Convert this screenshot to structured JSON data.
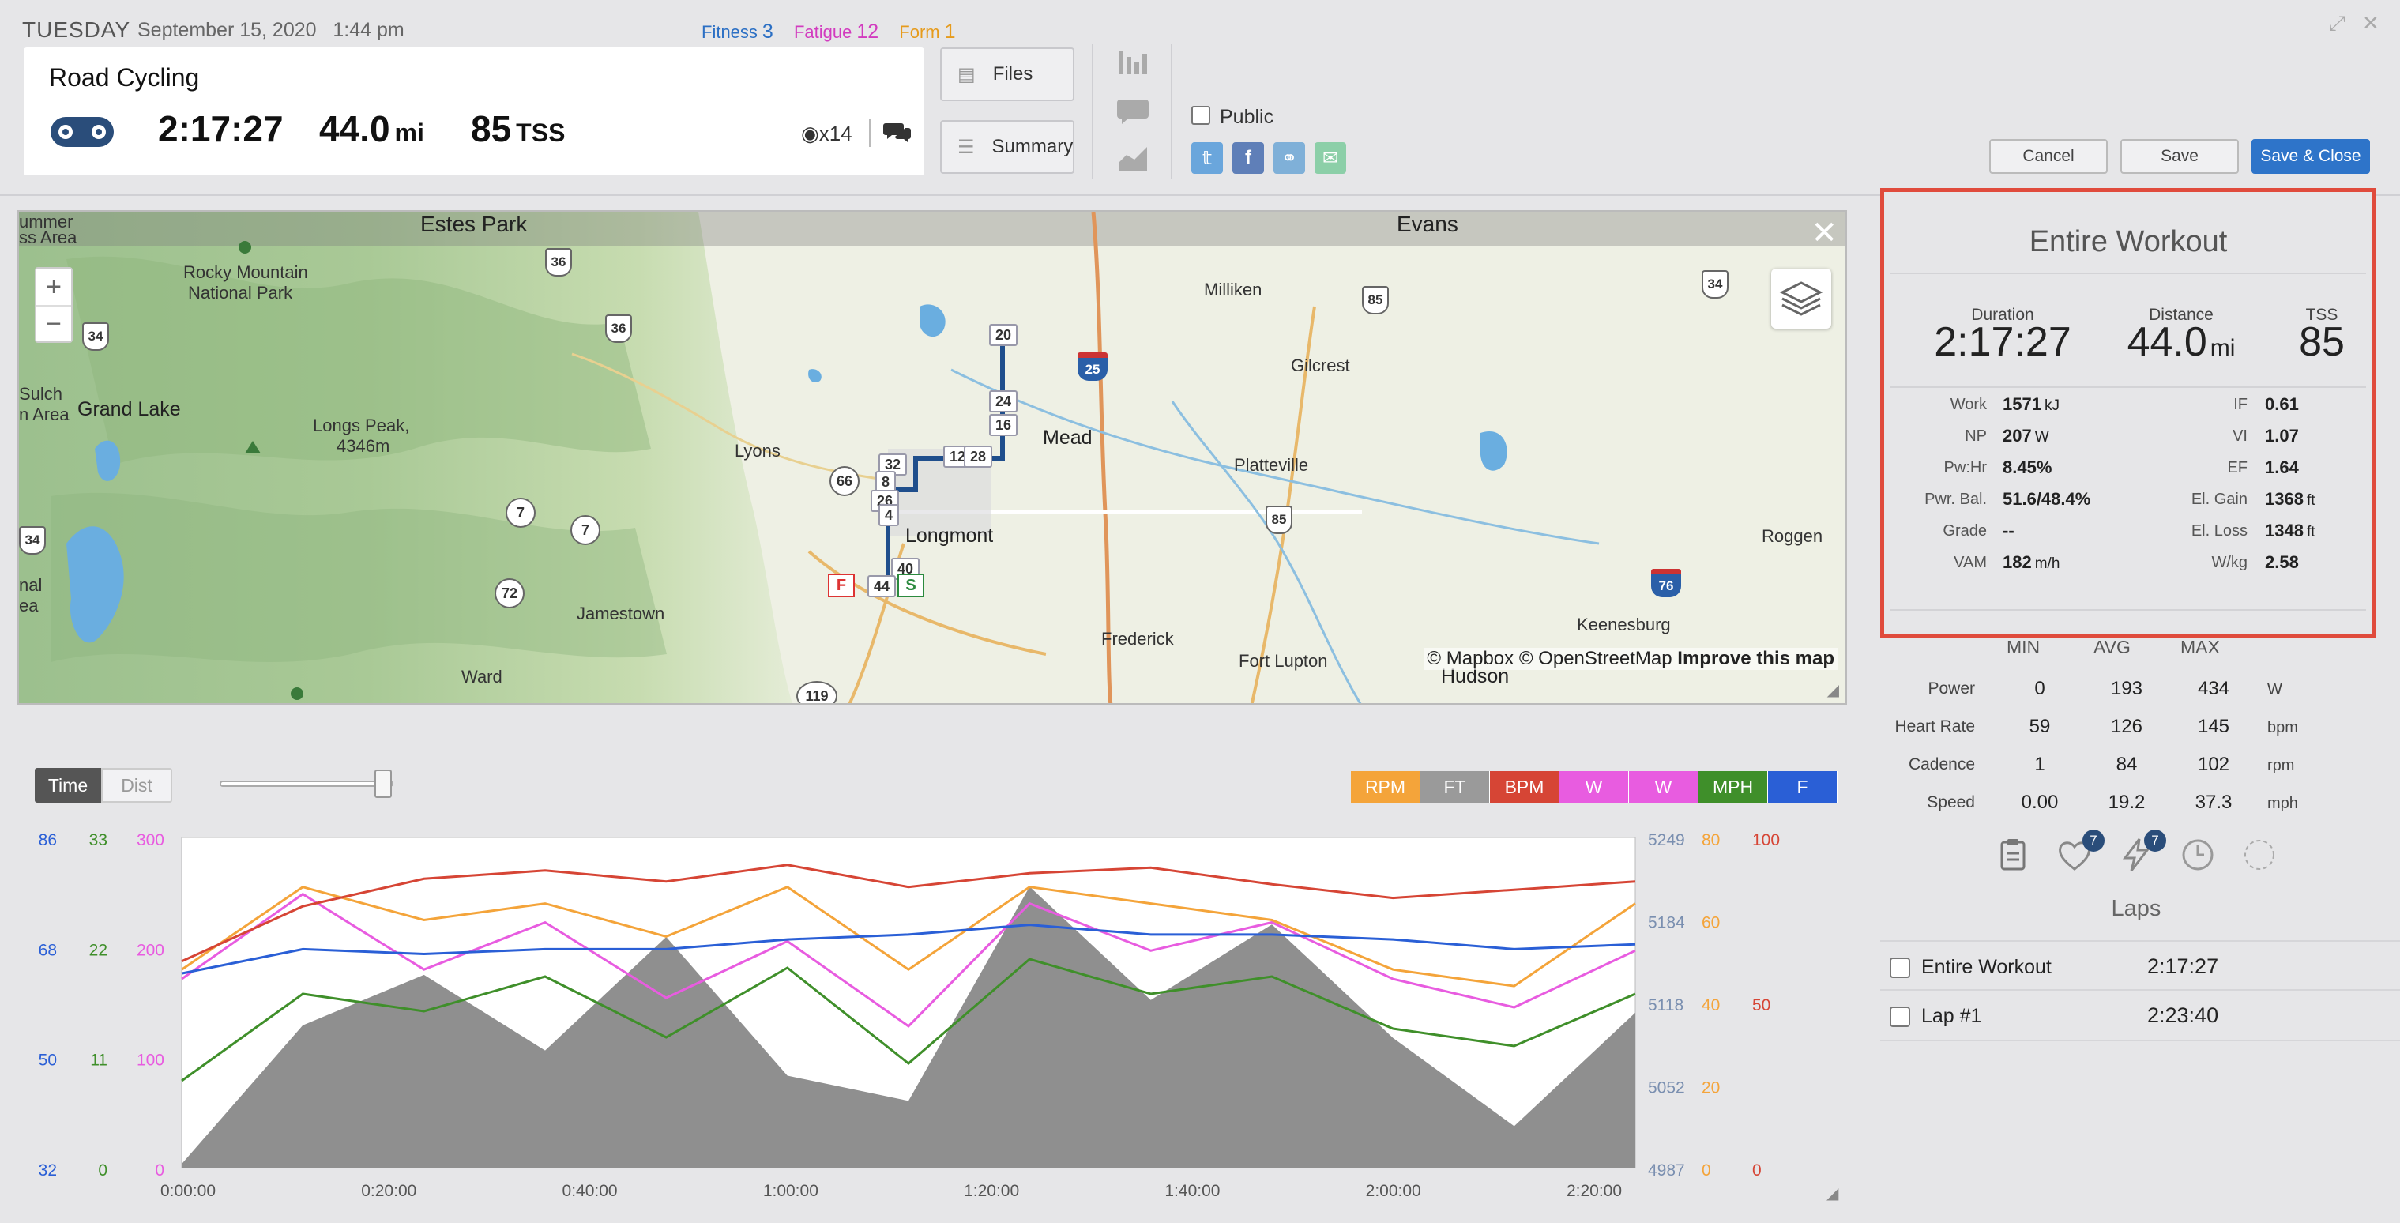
{
  "header": {
    "day": "TUESDAY",
    "date": "September 15, 2020",
    "time": "1:44 pm",
    "fitness_label": "Fitness",
    "fitness_value": "3",
    "fatigue_label": "Fatigue",
    "fatigue_value": "12",
    "form_label": "Form",
    "form_value": "1"
  },
  "workout": {
    "sport": "Road Cycling",
    "duration": "2:17:27",
    "distance": "44.0",
    "distance_unit": "mi",
    "tss": "85",
    "tss_unit": "TSS",
    "medals": "x14"
  },
  "side_buttons": {
    "files": "Files",
    "summary": "Summary"
  },
  "sharing": {
    "public_label": "Public",
    "public_checked": false
  },
  "actions": {
    "cancel": "Cancel",
    "save": "Save",
    "save_close": "Save & Close"
  },
  "map": {
    "labels": {
      "estes_park": "Estes Park",
      "evans": "Evans",
      "rocky_mountain": "Rocky Mountain",
      "national_park": "National Park",
      "milliken": "Milliken",
      "gilcrest": "Gilcrest",
      "grand_lake": "Grand Lake",
      "longs_peak": "Longs Peak,",
      "longs_elev": "4346m",
      "mead": "Mead",
      "lyons": "Lyons",
      "platteville": "Platteville",
      "longmont": "Longmont",
      "roggen": "Roggen",
      "jamestown": "Jamestown",
      "frederick": "Frederick",
      "keenesburg": "Keenesburg",
      "fort_lupton": "Fort Lupton",
      "hudson": "Hudson",
      "ward": "Ward",
      "summer": "ummer",
      "ss_area": "ss Area",
      "sulch": "Sulch",
      "n_area": "n Area",
      "nal": "nal",
      "ea": "ea"
    },
    "roads": {
      "r36a": "36",
      "r36b": "36",
      "r34a": "34",
      "r34b": "34",
      "r34c": "34",
      "r7a": "7",
      "r7b": "7",
      "r72": "72",
      "r66": "66",
      "r85a": "85",
      "r85b": "85",
      "r119": "119",
      "i25": "25",
      "i76": "76"
    },
    "laps": [
      "20",
      "24",
      "16",
      "12",
      "28",
      "32",
      "8",
      "26",
      "4",
      "40",
      "44"
    ],
    "start": "S",
    "finish": "F",
    "zoom_in": "+",
    "zoom_out": "−",
    "attribution_1": "© Mapbox",
    "attribution_2": "© OpenStreetMap",
    "attribution_link": "Improve this map"
  },
  "chart_controls": {
    "time": "Time",
    "dist": "Dist",
    "channels": [
      {
        "label": "RPM",
        "color": "#f4a43a"
      },
      {
        "label": "FT",
        "color": "#9a9a9a"
      },
      {
        "label": "BPM",
        "color": "#d64535"
      },
      {
        "label": "W",
        "color": "#e85ce0"
      },
      {
        "label": "W",
        "color": "#e85ce0"
      },
      {
        "label": "MPH",
        "color": "#3f8f2a"
      },
      {
        "label": "F",
        "color": "#2a5fd6"
      }
    ]
  },
  "chart_data": {
    "type": "line",
    "x_ticks": [
      "0:00:00",
      "0:20:00",
      "0:40:00",
      "1:00:00",
      "1:20:00",
      "1:40:00",
      "2:00:00",
      "2:20:00"
    ],
    "axes": {
      "blue_f": {
        "ticks": [
          "86",
          "68",
          "50",
          "32"
        ],
        "color": "#2a5fd6"
      },
      "green_mph": {
        "ticks": [
          "33",
          "22",
          "11",
          "0"
        ],
        "color": "#3f8f2a"
      },
      "magenta_w": {
        "ticks": [
          "300",
          "200",
          "100",
          "0"
        ],
        "color": "#e85ce0"
      },
      "elevation_ft": {
        "ticks": [
          "5249",
          "5184",
          "5118",
          "5052",
          "4987"
        ],
        "color": "#7a8fb0"
      },
      "orange_rpm": {
        "ticks": [
          "80",
          "60",
          "40",
          "20",
          "0"
        ],
        "color": "#f4a43a"
      },
      "red_bpm": {
        "ticks": [
          "100",
          "50",
          "0"
        ],
        "color": "#d64535"
      }
    },
    "series": [
      {
        "name": "FT",
        "values": [
          4990,
          5100,
          5140,
          5080,
          5170,
          5060,
          5040,
          5210,
          5120,
          5180,
          5090,
          5020,
          5110
        ]
      },
      {
        "name": "BPM",
        "values": [
          75,
          95,
          105,
          108,
          104,
          110,
          102,
          107,
          109,
          103,
          98,
          101,
          104
        ]
      },
      {
        "name": "RPM",
        "values": [
          60,
          85,
          75,
          80,
          70,
          85,
          60,
          85,
          80,
          75,
          60,
          55,
          80
        ]
      },
      {
        "name": "W",
        "values": [
          200,
          290,
          210,
          260,
          180,
          240,
          150,
          280,
          230,
          260,
          200,
          170,
          230
        ]
      },
      {
        "name": "MPH",
        "values": [
          10,
          20,
          18,
          22,
          15,
          23,
          12,
          24,
          20,
          22,
          16,
          14,
          20
        ]
      },
      {
        "name": "F",
        "values": [
          72,
          77,
          76,
          77,
          77,
          79,
          80,
          82,
          80,
          80,
          79,
          77,
          78
        ]
      }
    ]
  },
  "summary": {
    "title": "Entire Workout",
    "duration_label": "Duration",
    "duration": "2:17:27",
    "distance_label": "Distance",
    "distance": "44.0",
    "distance_unit": "mi",
    "tss_label": "TSS",
    "tss": "85",
    "left_rows": [
      {
        "label": "Work",
        "value": "1571",
        "unit": "kJ"
      },
      {
        "label": "NP",
        "value": "207",
        "unit": "W"
      },
      {
        "label": "Pw:Hr",
        "value": "8.45%",
        "unit": ""
      },
      {
        "label": "Pwr. Bal.",
        "value": "51.6/48.4%",
        "unit": ""
      },
      {
        "label": "Grade",
        "value": "--",
        "unit": ""
      },
      {
        "label": "VAM",
        "value": "182",
        "unit": "m/h"
      }
    ],
    "right_rows": [
      {
        "label": "IF",
        "value": "0.61",
        "unit": ""
      },
      {
        "label": "VI",
        "value": "1.07",
        "unit": ""
      },
      {
        "label": "EF",
        "value": "1.64",
        "unit": ""
      },
      {
        "label": "El. Gain",
        "value": "1368",
        "unit": "ft"
      },
      {
        "label": "El. Loss",
        "value": "1348",
        "unit": "ft"
      },
      {
        "label": "W/kg",
        "value": "2.58",
        "unit": ""
      }
    ]
  },
  "minmax": {
    "headers": [
      "MIN",
      "AVG",
      "MAX"
    ],
    "rows": [
      {
        "label": "Power",
        "min": "0",
        "avg": "193",
        "max": "434",
        "unit": "W"
      },
      {
        "label": "Heart Rate",
        "min": "59",
        "avg": "126",
        "max": "145",
        "unit": "bpm"
      },
      {
        "label": "Cadence",
        "min": "1",
        "avg": "84",
        "max": "102",
        "unit": "rpm"
      },
      {
        "label": "Speed",
        "min": "0.00",
        "avg": "19.2",
        "max": "37.3",
        "unit": "mph"
      }
    ]
  },
  "tabs": {
    "heart_badge": "7",
    "bolt_badge": "7"
  },
  "laps": {
    "title": "Laps",
    "items": [
      {
        "name": "Entire Workout",
        "time": "2:17:27"
      },
      {
        "name": "Lap #1",
        "time": "2:23:40"
      }
    ]
  }
}
